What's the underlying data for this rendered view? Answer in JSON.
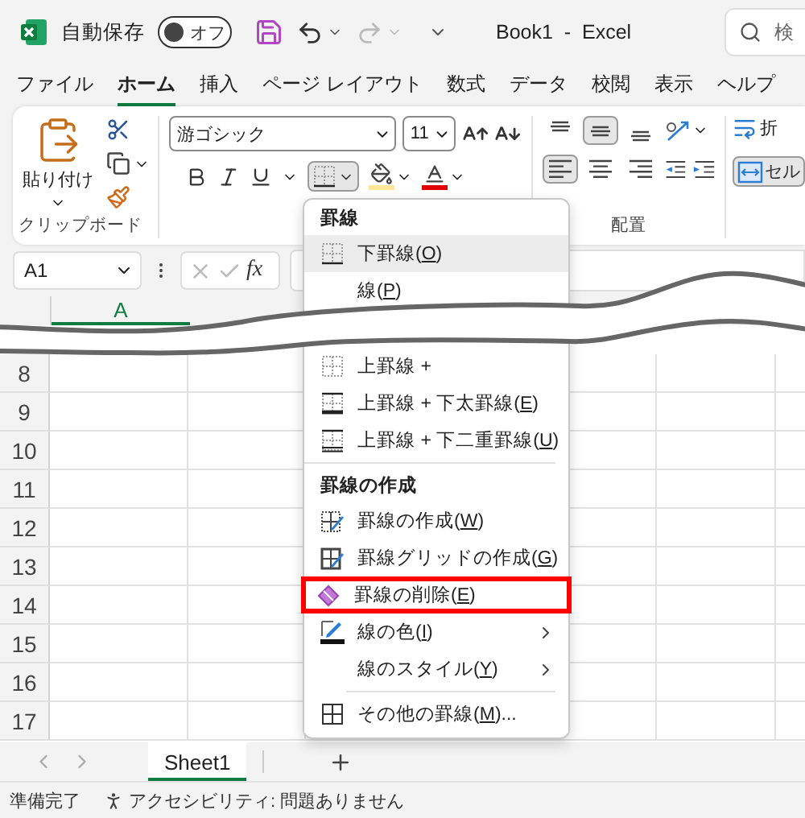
{
  "title_bar": {
    "autosave_label": "自動保存",
    "autosave": {
      "on": false,
      "label": "オフ"
    },
    "redo": {
      "disabled": true
    },
    "document_title": "Book1  -  Excel",
    "search_placeholder": "検"
  },
  "ribbon_tabs": [
    {
      "label": "ファイル",
      "selected": false
    },
    {
      "label": "ホーム",
      "selected": true
    },
    {
      "label": "挿入",
      "selected": false
    },
    {
      "label": "ページ レイアウト",
      "selected": false
    },
    {
      "label": "数式",
      "selected": false
    },
    {
      "label": "データ",
      "selected": false
    },
    {
      "label": "校閲",
      "selected": false
    },
    {
      "label": "表示",
      "selected": false
    },
    {
      "label": "ヘルプ",
      "selected": false
    }
  ],
  "ribbon": {
    "clipboard": {
      "paste_label": "貼り付け",
      "group_label": "クリップボード"
    },
    "font": {
      "font_name": "游ゴシック",
      "font_size": "11",
      "borders_open": true
    },
    "alignment": {
      "vertical": [
        {
          "selected": false
        },
        {
          "selected": true
        },
        {
          "selected": false
        }
      ],
      "horizontal": [
        {
          "selected": true
        },
        {
          "selected": false
        },
        {
          "selected": false
        }
      ],
      "group_label": "配置"
    },
    "wrap": {
      "label": "折"
    },
    "merge": {
      "label": "セル",
      "selected": true
    }
  },
  "formula_bar": {
    "name_box": "A1",
    "function_label": "fx"
  },
  "sheet": {
    "columns": [
      {
        "label": "A",
        "selected": true
      }
    ],
    "rows": [
      "8",
      "9",
      "10",
      "11",
      "12",
      "13",
      "14",
      "15",
      "16",
      "17"
    ]
  },
  "sheet_tabs": [
    {
      "label": "Sheet1",
      "selected": true
    }
  ],
  "status_bar": {
    "mode": "準備完了",
    "accessibility": "アクセシビリティ: 問題ありません"
  },
  "borders_menu": {
    "sections": [
      {
        "title": "罫線",
        "items": [
          {
            "text": "下罫線(",
            "key": "O",
            "after": ")",
            "selected": true,
            "highlighted": false,
            "submenu": false
          },
          {
            "text": "線(",
            "key": "P",
            "after": ")",
            "selected": false,
            "highlighted": false,
            "submenu": false
          },
          {
            "text": "上罫線 +",
            "selected": false,
            "highlighted": false,
            "submenu": false
          },
          {
            "text": "上罫線 + 下太罫線(",
            "key": "E",
            "after": ")",
            "selected": false,
            "highlighted": false,
            "submenu": false
          },
          {
            "text": "上罫線 + 下二重罫線(",
            "key": "U",
            "after": ")",
            "selected": false,
            "highlighted": false,
            "submenu": false
          }
        ]
      },
      {
        "title": "罫線の作成",
        "items": [
          {
            "text": "罫線の作成(",
            "key": "W",
            "after": ")",
            "selected": false,
            "highlighted": false,
            "submenu": false
          },
          {
            "text": "罫線グリッドの作成(",
            "key": "G",
            "after": ")",
            "selected": false,
            "highlighted": false,
            "submenu": false
          },
          {
            "text": "罫線の削除(",
            "key": "E",
            "after": ")",
            "selected": false,
            "highlighted": true,
            "submenu": false
          },
          {
            "text": "線の色(",
            "key": "I",
            "after": ")",
            "selected": false,
            "highlighted": false,
            "submenu": true
          },
          {
            "text": "線のスタイル(",
            "key": "Y",
            "after": ")",
            "selected": false,
            "highlighted": false,
            "submenu": true
          }
        ]
      },
      {
        "items": [
          {
            "text": "その他の罫線(",
            "key": "M",
            "after": ")...",
            "selected": false,
            "highlighted": false,
            "submenu": false
          }
        ]
      }
    ]
  }
}
